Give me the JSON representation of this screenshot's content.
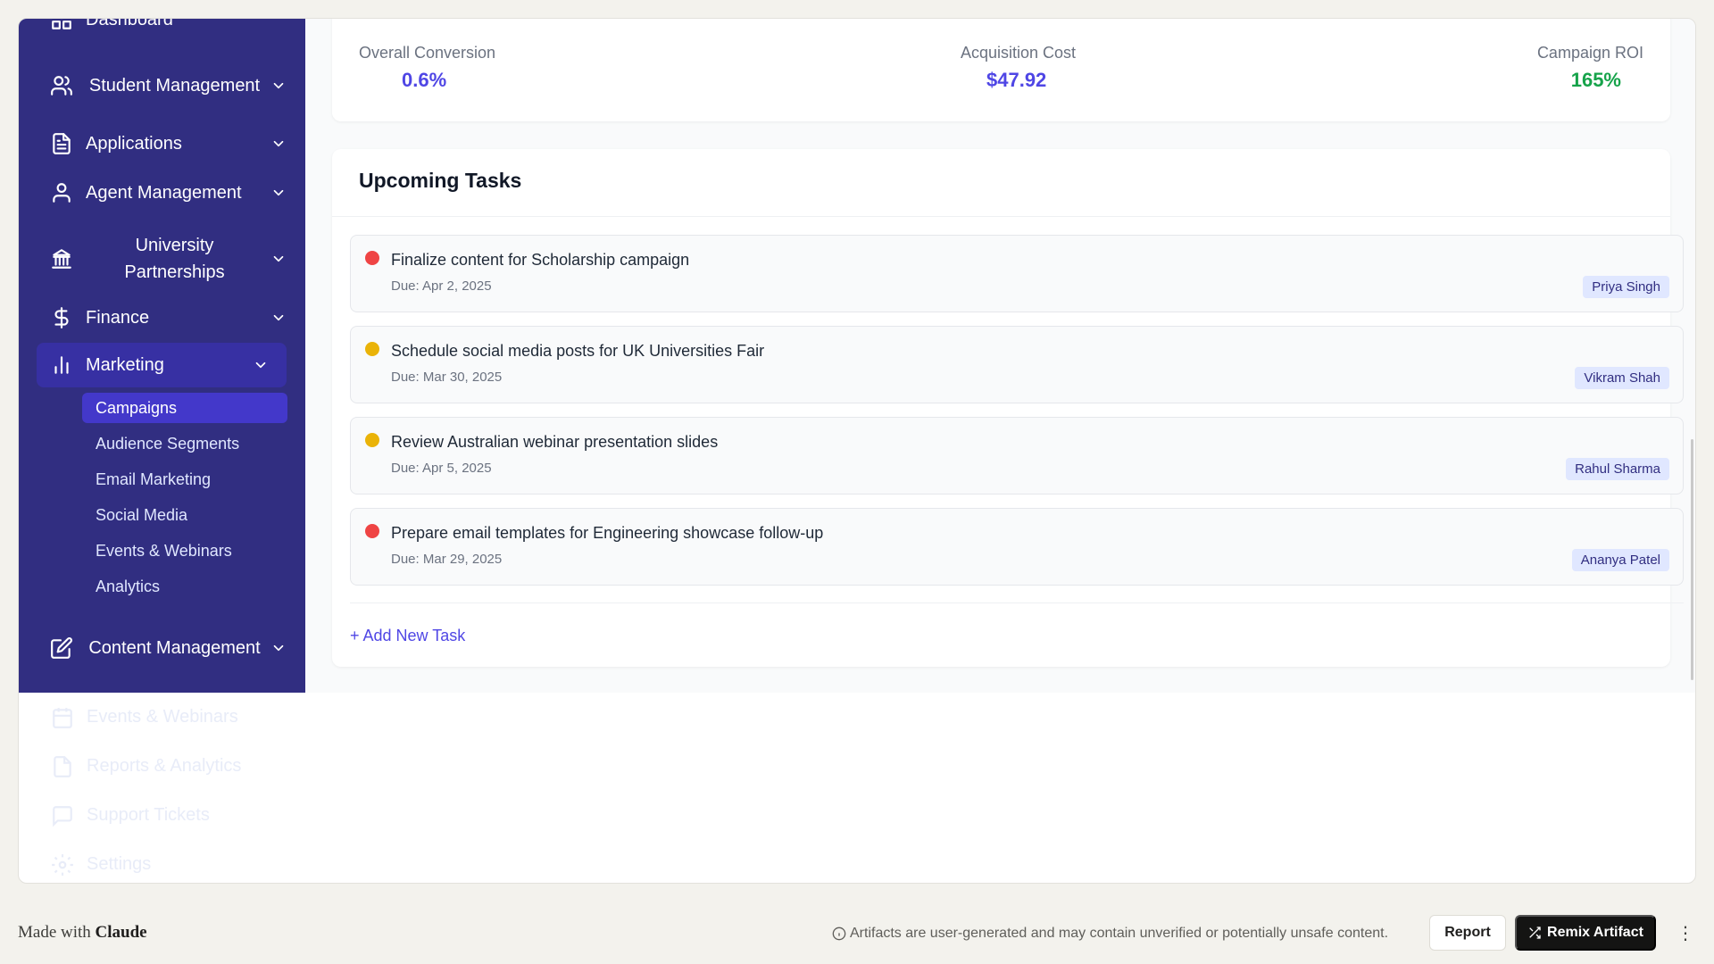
{
  "sidebar": {
    "items": [
      {
        "label": "Dashboard",
        "icon": "grid-icon"
      },
      {
        "label": "Student Management",
        "icon": "users-icon"
      },
      {
        "label": "Applications",
        "icon": "file-icon"
      },
      {
        "label": "Agent Management",
        "icon": "user-icon"
      },
      {
        "label": "University Partnerships",
        "icon": "university-icon"
      },
      {
        "label": "Finance",
        "icon": "dollar-icon"
      },
      {
        "label": "Marketing",
        "icon": "bar-chart-icon"
      },
      {
        "label": "Content Management",
        "icon": "edit-icon"
      }
    ],
    "marketing_sub": [
      "Campaigns",
      "Audience Segments",
      "Email Marketing",
      "Social Media",
      "Events & Webinars",
      "Analytics"
    ],
    "faded_items": [
      {
        "label": "Events & Webinars",
        "icon": "calendar-icon"
      },
      {
        "label": "Reports & Analytics",
        "icon": "report-icon"
      },
      {
        "label": "Support Tickets",
        "icon": "message-icon"
      },
      {
        "label": "Settings",
        "icon": "gear-icon"
      }
    ]
  },
  "metrics": {
    "conversion_label": "Overall Conversion",
    "conversion_value": "0.6%",
    "cost_label": "Acquisition Cost",
    "cost_value": "$47.92",
    "roi_label": "Campaign ROI",
    "roi_value": "165%",
    "colors": {
      "primary": "#4f46e5",
      "positive": "#16a34a"
    }
  },
  "tasks": {
    "title": "Upcoming Tasks",
    "items": [
      {
        "title": "Finalize content for Scholarship campaign",
        "due": "Due: Apr 2, 2025",
        "assignee": "Priya Singh",
        "priority_color": "#ef4444"
      },
      {
        "title": "Schedule social media posts for UK Universities Fair",
        "due": "Due: Mar 30, 2025",
        "assignee": "Vikram Shah",
        "priority_color": "#eab308"
      },
      {
        "title": "Review Australian webinar presentation slides",
        "due": "Due: Apr 5, 2025",
        "assignee": "Rahul Sharma",
        "priority_color": "#eab308"
      },
      {
        "title": "Prepare email templates for Engineering showcase follow-up",
        "due": "Due: Mar 29, 2025",
        "assignee": "Ananya Patel",
        "priority_color": "#ef4444"
      }
    ],
    "add_label": "+ Add New Task"
  },
  "footer": {
    "made_with_prefix": "Made with",
    "made_with_brand": "Claude",
    "disclaimer": "Artifacts are user-generated and may contain unverified or potentially unsafe content.",
    "report_label": "Report",
    "remix_label": "Remix Artifact",
    "more_label": "⋮"
  }
}
